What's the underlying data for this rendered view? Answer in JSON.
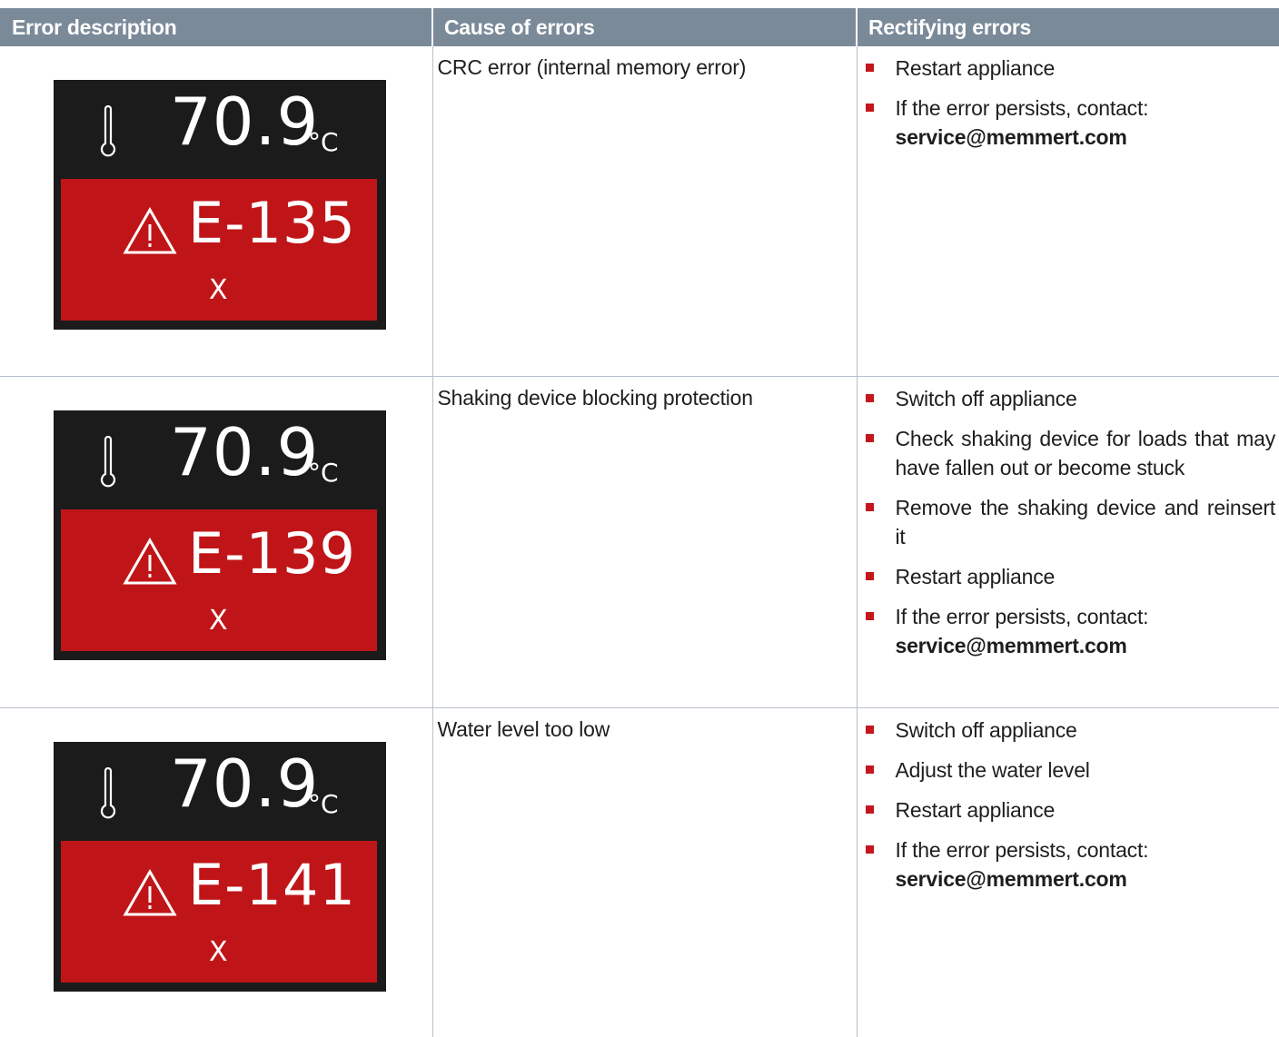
{
  "table": {
    "headers": {
      "col1": "Error description",
      "col2": "Cause of errors",
      "col3": "Rectifying errors"
    },
    "accent_color": "#c4161c",
    "header_color": "#7b8a99",
    "rows": [
      {
        "display": {
          "temperature": "70.9",
          "unit": "°C",
          "error_code": "E-135",
          "close_glyph": "X"
        },
        "cause": "CRC error (internal memory error)",
        "steps": [
          {
            "text": "Restart appliance"
          },
          {
            "text": "If the error persists, contact:",
            "contact": "service@memmert.com"
          }
        ]
      },
      {
        "display": {
          "temperature": "70.9",
          "unit": "°C",
          "error_code": "E-139",
          "close_glyph": "X"
        },
        "cause": "Shaking device blocking protection",
        "steps": [
          {
            "text": "Switch off appliance"
          },
          {
            "text": "Check shaking device for loads that may have fallen out or become stuck"
          },
          {
            "text": "Remove the shaking device and reinsert it"
          },
          {
            "text": "Restart appliance"
          },
          {
            "text": "If the error persists, contact:",
            "contact": "service@memmert.com"
          }
        ]
      },
      {
        "display": {
          "temperature": "70.9",
          "unit": "°C",
          "error_code": "E-141",
          "close_glyph": "X"
        },
        "cause": "Water level too low",
        "steps": [
          {
            "text": "Switch off appliance"
          },
          {
            "text": "Adjust the water level"
          },
          {
            "text": "Restart appliance"
          },
          {
            "text": "If the error persists, contact:",
            "contact": "service@memmert.com"
          }
        ]
      }
    ]
  }
}
